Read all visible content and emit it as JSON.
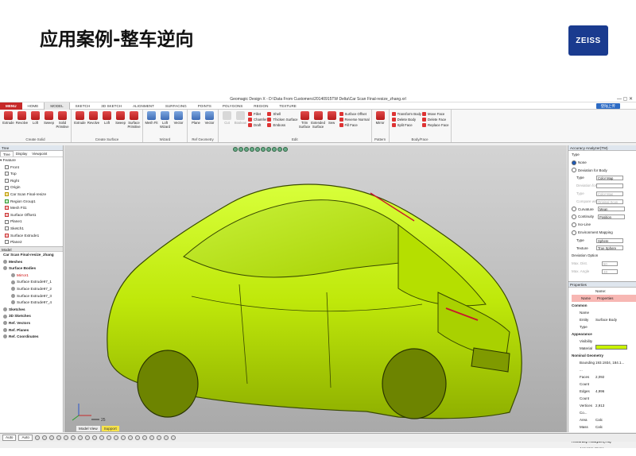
{
  "slide": {
    "title": "应用案例-整车逆向",
    "logo": "ZEISS"
  },
  "window": {
    "title": "Geomagic Design X - D:\\Data From Customers\\20140915TW Delta\\Car Scan Final-resize_zhang.xrl"
  },
  "ribbon_tabs": [
    "MENU",
    "HOME",
    "MODEL",
    "SKETCH",
    "3D SKETCH",
    "ALIGNMENT",
    "SURFACING",
    "POINTS",
    "POLYGONS",
    "REGION",
    "TEXTURE"
  ],
  "active_tab": "MODEL",
  "login_button": "登陆上传",
  "ribbon_groups": [
    {
      "label": "Create Solid",
      "buttons": [
        "Extrude",
        "Revolve",
        "Loft",
        "Sweep",
        "Solid Primitive"
      ]
    },
    {
      "label": "Create Surface",
      "buttons": [
        "Extrude",
        "Revolve",
        "Loft",
        "Sweep",
        "Surface Primitive"
      ]
    },
    {
      "label": "Wizard",
      "buttons": [
        "Mesh Fit",
        "Loft Wizard",
        "Vector"
      ]
    },
    {
      "label": "Ref Geometry",
      "buttons": [
        "Plane",
        "Vector"
      ]
    },
    {
      "label": "Edit",
      "buttons": [
        "Cut",
        "Boolean"
      ],
      "small": [
        "Fillet",
        "Chamfer",
        "Draft",
        "Shell",
        "Thicken Surface",
        "Emboss"
      ],
      "buttons2": [
        "Trim Surface",
        "Extended Surface",
        "Sew"
      ],
      "small2": [
        "Surface Offset",
        "Reverse Normal",
        "Fill Face"
      ]
    },
    {
      "label": "Pattern",
      "buttons": [
        "Mirror"
      ]
    },
    {
      "label": "Body/Face",
      "small": [
        "Transform Body",
        "Delete Body",
        "Split Face",
        "Move Face",
        "Delete Face",
        "Replace Face"
      ]
    }
  ],
  "left_panel": {
    "header": "Tree",
    "tabs": [
      "Tree",
      "Display",
      "Viewpoint"
    ],
    "feature_root": "Feature",
    "features": [
      "Front",
      "Top",
      "Right",
      "Origin",
      "Car Scan Final-resize",
      "Region Group1",
      "Mesh Fit1",
      "Surface Offset1",
      "Plane1",
      "Sketch1",
      "Surface Extrude1",
      "Plane2",
      "Sketch2",
      "Surface Extrude2",
      "Trim1",
      "Fillet1 (Constant)",
      "Trim2",
      "Mesh Fit2",
      "Mesh Fit3"
    ],
    "model_header": "Model",
    "model_root": "Car Scan Final-resize_zhang",
    "model_items": [
      {
        "label": "Meshes",
        "bold": true
      },
      {
        "label": "Surface Bodies",
        "bold": true
      },
      {
        "label": "Mirror1",
        "indent": 2,
        "red": true
      },
      {
        "label": "Surface Extrude97_1",
        "indent": 2
      },
      {
        "label": "Surface Extrude97_2",
        "indent": 2
      },
      {
        "label": "Surface Extrude97_3",
        "indent": 2
      },
      {
        "label": "Surface Extrude97_4",
        "indent": 2
      },
      {
        "label": "Sketches",
        "bold": true
      },
      {
        "label": "3D Sketches",
        "bold": true
      },
      {
        "label": "Ref. Vectors",
        "bold": true
      },
      {
        "label": "Ref. Planes",
        "bold": true
      },
      {
        "label": "Ref. Coordinates",
        "bold": true
      }
    ]
  },
  "viewport": {
    "tabs": [
      "Model View",
      "Support"
    ],
    "scale": "25"
  },
  "accuracy": {
    "header": "Accuracy Analyzer(TM)",
    "type_label": "Type",
    "options": [
      "None",
      "Deviation for Body"
    ],
    "rows": [
      {
        "label": "Type",
        "value": "Color Map",
        "dis": false
      },
      {
        "label": "Deviation for Mesh",
        "value": "",
        "dis": true
      },
      {
        "label": "Type",
        "value": "Color Map",
        "dis": true
      },
      {
        "label": "Compare with",
        "value": "Original Scan",
        "dis": true
      }
    ],
    "checks": [
      {
        "label": "Curvature",
        "value": "Mean"
      },
      {
        "label": "Continuity",
        "value": "Position"
      }
    ],
    "more": [
      "Iso-Line",
      "Environment Mapping"
    ],
    "env_rows": [
      {
        "label": "Type",
        "value": "Sphere"
      },
      {
        "label": "Texture",
        "value": "True Sphere"
      }
    ],
    "deviation_option": "Deviation Option",
    "max_dist": {
      "label": "Max. Dist.",
      "value": "50"
    },
    "max_angle": {
      "label": "Max. Angle",
      "value": "40"
    }
  },
  "properties": {
    "header": "Properties",
    "name_label": "Name:",
    "name_row": {
      "k": "Name",
      "v": "Properties"
    },
    "common": "Common",
    "common_rows": [
      {
        "k": "Name",
        "v": ""
      },
      {
        "k": "Entity Type",
        "v": "Surface Body"
      }
    ],
    "appearance": "Appearance",
    "appearance_rows": [
      {
        "k": "Visibility",
        "v": ""
      },
      {
        "k": "Material",
        "v": ""
      }
    ],
    "nominal": "Nominal Geometry",
    "nominal_rows": [
      {
        "k": "Bounding ...",
        "v": "193.1934, 184.1..."
      },
      {
        "k": "Faces Count",
        "v": "2,092"
      },
      {
        "k": "Edges Count",
        "v": "4,996"
      },
      {
        "k": "Vertices Co...",
        "v": "2,913"
      },
      {
        "k": "Area",
        "v": "Calc"
      },
      {
        "k": "Mass Center",
        "v": "Calc"
      }
    ],
    "accuracy": "Accuracy Analyzer(TM)",
    "accuracy_rows": [
      {
        "k": "Accuracy ...",
        "v": "None"
      }
    ],
    "material_color": "#c8f200"
  },
  "status": {
    "mode": "Auto",
    "unit": "Auto"
  }
}
